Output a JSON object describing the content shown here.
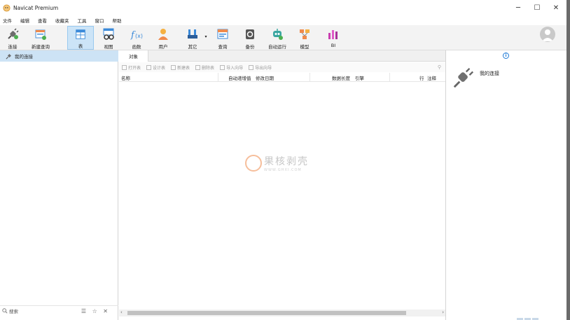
{
  "window": {
    "title": "Navicat Premium",
    "minimize": "─",
    "maximize": "☐",
    "close": "✕"
  },
  "menu": [
    "文件",
    "编辑",
    "查看",
    "收藏夹",
    "工具",
    "窗口",
    "帮助"
  ],
  "toolbar": [
    {
      "id": "connection",
      "label": "连接",
      "icon": "plug-icon"
    },
    {
      "id": "new-query",
      "label": "新建查询",
      "icon": "new-query-icon"
    },
    {
      "id": "table",
      "label": "表",
      "icon": "table-icon",
      "active": true
    },
    {
      "id": "view",
      "label": "视图",
      "icon": "view-icon"
    },
    {
      "id": "function",
      "label": "函数",
      "icon": "function-icon"
    },
    {
      "id": "user",
      "label": "用户",
      "icon": "user-icon"
    },
    {
      "id": "other",
      "label": "其它",
      "icon": "tools-icon"
    },
    {
      "id": "query",
      "label": "查询",
      "icon": "query-icon"
    },
    {
      "id": "backup",
      "label": "备份",
      "icon": "backup-icon"
    },
    {
      "id": "automation",
      "label": "自动运行",
      "icon": "robot-icon"
    },
    {
      "id": "model",
      "label": "模型",
      "icon": "model-icon"
    },
    {
      "id": "bi",
      "label": "BI",
      "icon": "bi-icon"
    }
  ],
  "sidebar": {
    "connection_label": "我的连接",
    "search_placeholder": "搜索",
    "search_tools": "☰ ☆ ✕"
  },
  "main": {
    "tab_label": "对象",
    "object_toolbar": [
      "打开表",
      "设计表",
      "新建表",
      "删除表",
      "导入向导",
      "导出向导"
    ],
    "columns": [
      "名称",
      "自动递增值",
      "修改日期",
      "数据长度",
      "引擎",
      "行",
      "注释"
    ]
  },
  "info_panel": {
    "connection_label": "我的连接"
  },
  "watermark": {
    "text": "果核剥壳",
    "url": "WWW.GHXI.COM"
  },
  "colors": {
    "accent": "#1e7ad6",
    "selection": "#cde3f5",
    "active_tool": "#cce4f7"
  }
}
